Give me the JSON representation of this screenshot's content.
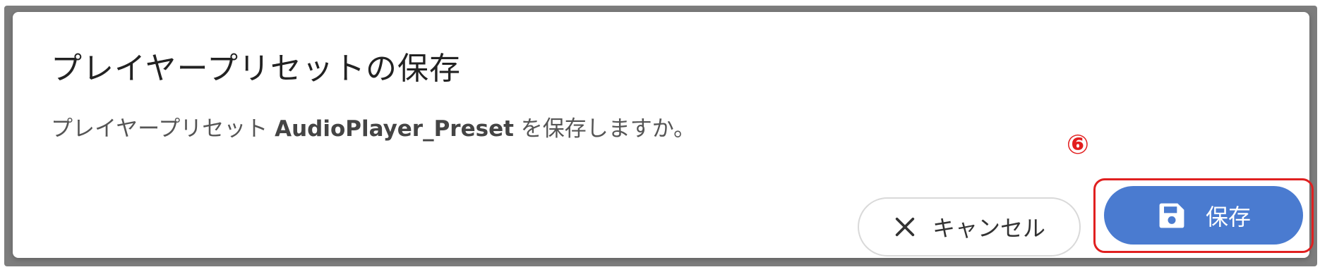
{
  "dialog": {
    "title": "プレイヤープリセットの保存",
    "message": {
      "prefix": "プレイヤープリセット ",
      "preset_name": "AudioPlayer_Preset",
      "suffix": " を保存しますか。"
    },
    "buttons": {
      "cancel": {
        "label": "キャンセル",
        "icon": "close-icon"
      },
      "save": {
        "label": "保存",
        "icon": "save-icon"
      }
    }
  },
  "annotation": {
    "step_marker": "⑥"
  },
  "colors": {
    "primary": "#4a7bd0",
    "annotation_red": "#e02020",
    "title_text": "#222222",
    "message_text": "#555555"
  }
}
